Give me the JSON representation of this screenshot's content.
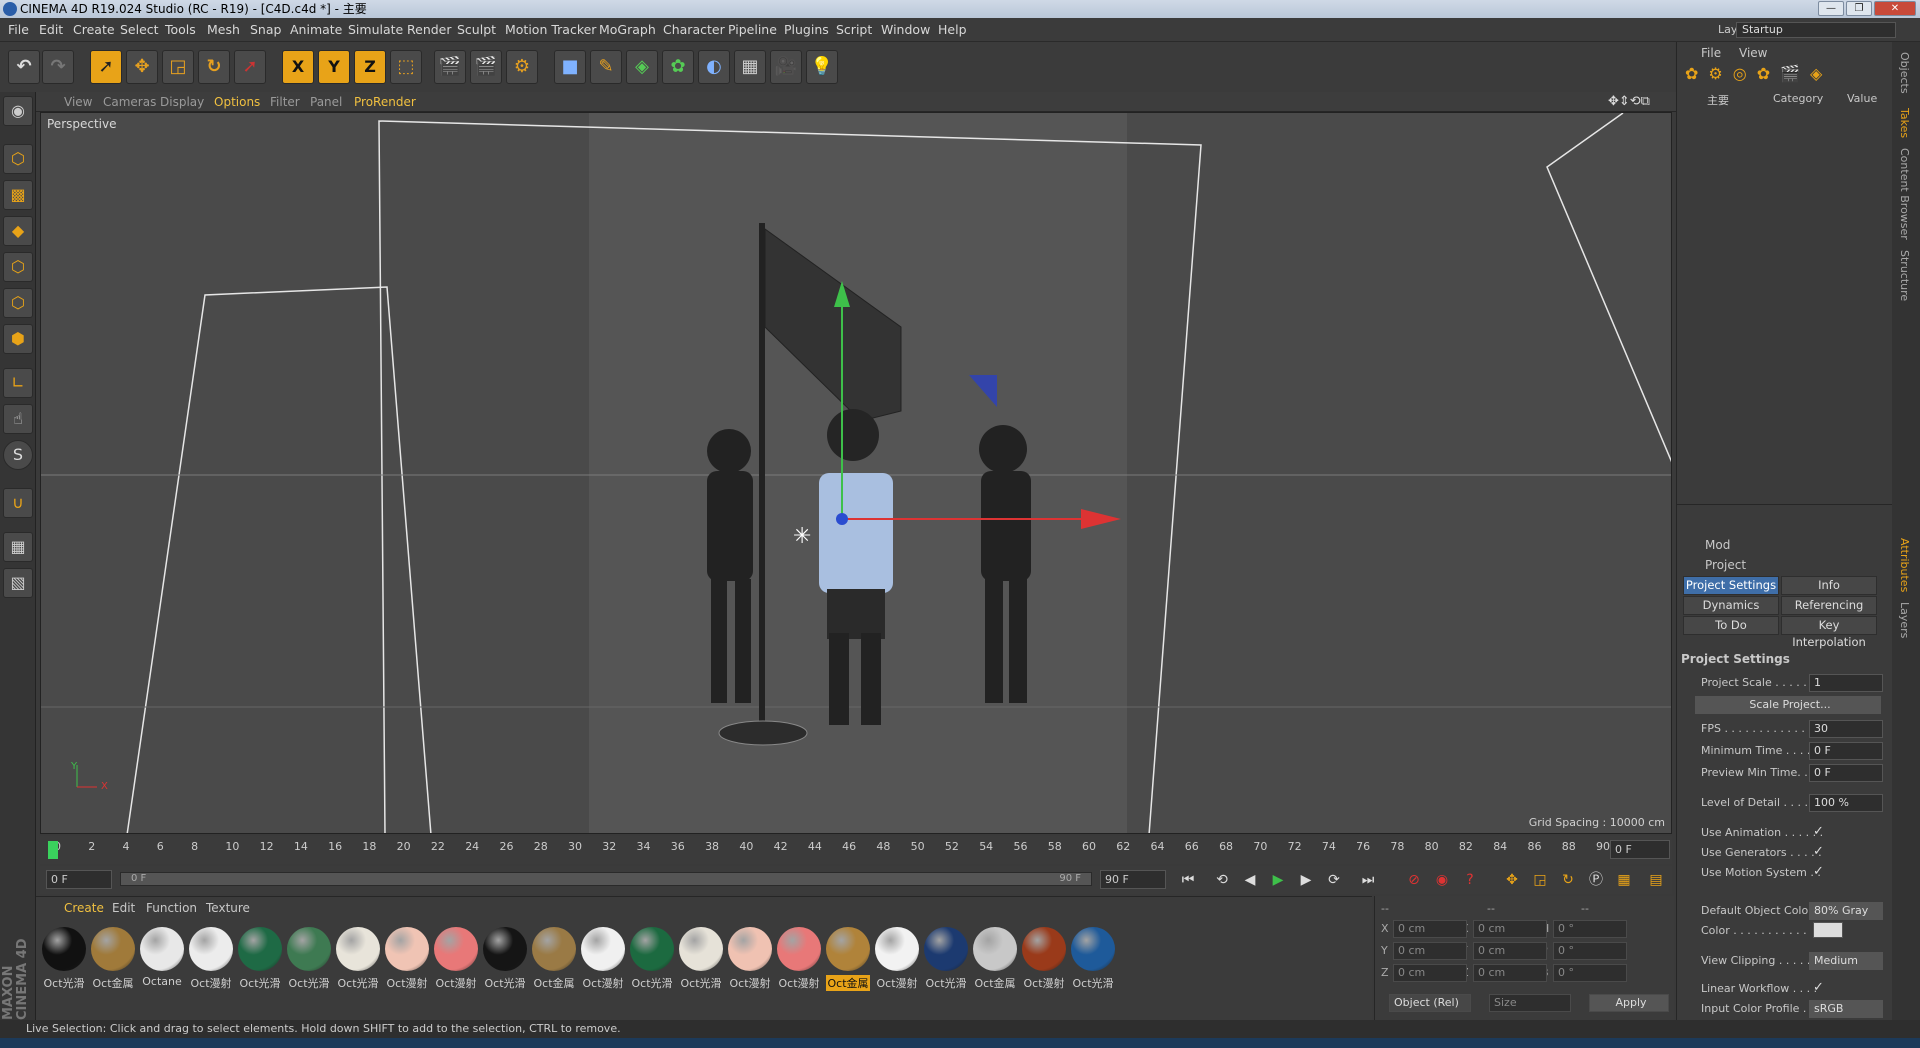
{
  "window": {
    "title": "CINEMA 4D R19.024 Studio (RC - R19) - [C4D.c4d *] - 主要"
  },
  "menu": [
    "File",
    "Edit",
    "Create",
    "Select",
    "Tools",
    "Mesh",
    "Snap",
    "Animate",
    "Simulate",
    "Render",
    "Sculpt",
    "Motion Tracker",
    "MoGraph",
    "Character",
    "Pipeline",
    "Plugins",
    "Script",
    "Window",
    "Help"
  ],
  "layout": {
    "label": "Layout:",
    "value": "Startup"
  },
  "toolbar": {
    "undo_icon": "undo-icon",
    "x": "X",
    "y": "Y",
    "z": "Z"
  },
  "viewport_menu": [
    "View",
    "Cameras",
    "Display",
    "Options",
    "Filter",
    "Panel",
    "ProRender"
  ],
  "viewport": {
    "label": "Perspective",
    "grid_spacing": "Grid Spacing : 10000 cm",
    "axis_y": "Y",
    "axis_x": "X"
  },
  "timeline": {
    "ticks": [
      "0",
      "2",
      "4",
      "6",
      "8",
      "10",
      "12",
      "14",
      "16",
      "18",
      "20",
      "22",
      "24",
      "26",
      "28",
      "30",
      "32",
      "34",
      "36",
      "38",
      "40",
      "42",
      "44",
      "46",
      "48",
      "50",
      "52",
      "54",
      "56",
      "58",
      "60",
      "62",
      "64",
      "66",
      "68",
      "70",
      "72",
      "74",
      "76",
      "78",
      "80",
      "82",
      "84",
      "86",
      "88",
      "90"
    ],
    "current": "0 F"
  },
  "controls": {
    "start": "0 F",
    "range_start": "0 F",
    "range_end": "90 F",
    "end": "90 F"
  },
  "material_manager": {
    "menu": [
      "Create",
      "Edit",
      "Function",
      "Texture"
    ],
    "materials": [
      {
        "label": "Oct光滑",
        "color": "#111"
      },
      {
        "label": "Oct金属",
        "color": "#a07a3a"
      },
      {
        "label": "Octane",
        "color": "#e8e8e8"
      },
      {
        "label": "Oct漫射",
        "color": "#ececec"
      },
      {
        "label": "Oct光滑",
        "color": "#1e6a45"
      },
      {
        "label": "Oct光滑",
        "color": "#3e7a52"
      },
      {
        "label": "Oct光滑",
        "color": "#e8e4da"
      },
      {
        "label": "Oct漫射",
        "color": "#f0c4b4"
      },
      {
        "label": "Oct漫射",
        "color": "#e87878"
      },
      {
        "label": "Oct光滑",
        "color": "#151515"
      },
      {
        "label": "Oct金属",
        "color": "#9a7a45"
      },
      {
        "label": "Oct漫射",
        "color": "#f0f0f0"
      },
      {
        "label": "Oct光滑",
        "color": "#1c6a40"
      },
      {
        "label": "Oct光滑",
        "color": "#e6e2d8"
      },
      {
        "label": "Oct漫射",
        "color": "#f0c2b2"
      },
      {
        "label": "Oct漫射",
        "color": "#e87878"
      },
      {
        "label": "Oct金属",
        "color": "#b0833a"
      },
      {
        "label": "Oct漫射",
        "color": "#f2f2f2"
      },
      {
        "label": "Oct光滑",
        "color": "#1c3a70"
      },
      {
        "label": "Oct金属",
        "color": "#c8c8c8"
      },
      {
        "label": "Oct漫射",
        "color": "#9a3a1a"
      },
      {
        "label": "Oct光滑",
        "color": "#1e5a9a"
      }
    ],
    "selected_index": 16
  },
  "coords": {
    "header": [
      "--",
      "--",
      "--"
    ],
    "rows": [
      {
        "a": "X",
        "av": "0 cm",
        "b": "X",
        "bv": "0 cm",
        "c": "H",
        "cv": "0 °"
      },
      {
        "a": "Y",
        "av": "0 cm",
        "b": "Y",
        "bv": "0 cm",
        "c": "P",
        "cv": "0 °"
      },
      {
        "a": "Z",
        "av": "0 cm",
        "b": "Z",
        "bv": "0 cm",
        "c": "B",
        "cv": "0 °"
      }
    ],
    "mode": "Object (Rel)",
    "size": "Size",
    "apply": "Apply"
  },
  "objects_panel": {
    "menu": [
      "File",
      "View"
    ],
    "col_name": "主要",
    "col_category": "Category",
    "col_value": "Value"
  },
  "attributes": {
    "mode": "Mod",
    "object": "Project",
    "tabs": [
      "Project Settings",
      "Info",
      "Dynamics",
      "Referencing",
      "To Do",
      "Key Interpolation"
    ],
    "section": "Project Settings",
    "fields": [
      {
        "label": "Project Scale . . . . . . .",
        "value": "1"
      },
      {
        "label": "FPS . . . . . . . . . . . . . . .",
        "value": "30"
      },
      {
        "label": "Minimum Time . . . . .",
        "value": "0 F"
      },
      {
        "label": "Preview Min Time. . .",
        "value": "0 F"
      },
      {
        "label": "Level of Detail . . . . . .",
        "value": "100 %"
      }
    ],
    "scale_button": "Scale Project...",
    "checks": [
      {
        "label": "Use Animation . . . . . .",
        "value": "✓"
      },
      {
        "label": "Use Generators . . . . .",
        "value": "✓"
      },
      {
        "label": "Use Motion System . .",
        "value": "✓"
      }
    ],
    "default_color_label": "Default Object Color",
    "default_color": "80% Gray",
    "color_label": "Color . . . . . . . . . . .",
    "view_clipping_label": "View Clipping . . . . . .",
    "view_clipping": "Medium",
    "linear_label": "Linear Workflow . . . .",
    "linear": "✓",
    "input_profile_label": "Input Color Profile . .",
    "input_profile": "sRGB"
  },
  "side_tabs_top": [
    "Objects",
    "Takes",
    "Content Browser",
    "Structure"
  ],
  "side_tabs_bottom": [
    "Attributes",
    "Layers"
  ],
  "status": "Live Selection: Click and drag to select elements. Hold down SHIFT to add to the selection, CTRL to remove.",
  "logo": "MAXON CINEMA 4D"
}
